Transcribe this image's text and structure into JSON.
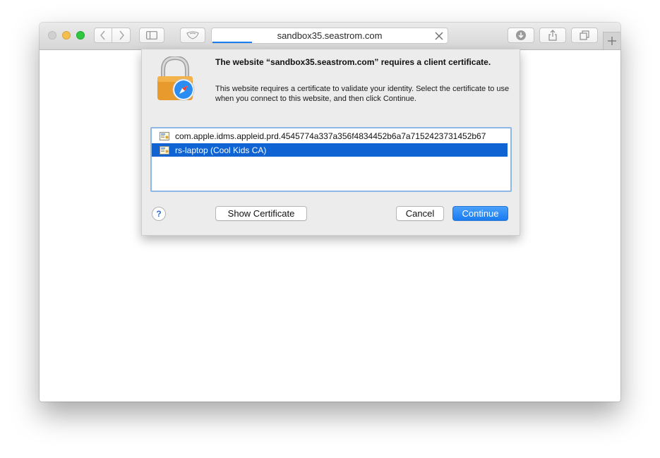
{
  "browser": {
    "address": "sandbox35.seastrom.com",
    "icons": {
      "back": "chevron-left-icon",
      "forward": "chevron-right-icon",
      "sidebar": "sidebar-icon",
      "shield": "shield-icon",
      "downloads": "download-icon",
      "share": "share-icon",
      "tabs": "tabs-overview-icon",
      "new_tab": "plus-icon",
      "stop": "close-icon"
    }
  },
  "dialog": {
    "title": "The website “sandbox35.seastrom.com” requires a client certificate.",
    "description": "This website requires a certificate to validate your identity. Select the certificate to use when you connect to this website, and then click Continue.",
    "certificates": [
      {
        "label": "com.apple.idms.appleid.prd.4545774a337a356f4834452b6a7a7152423731452b67",
        "selected": false
      },
      {
        "label": "rs-laptop  (Cool Kids CA)",
        "selected": true
      }
    ],
    "help_label": "?",
    "show_certificate_label": "Show Certificate",
    "cancel_label": "Cancel",
    "continue_label": "Continue"
  },
  "colors": {
    "accent": "#1a7cf0",
    "selection": "#0f63d3",
    "list_focus_ring": "#8db8e6"
  }
}
